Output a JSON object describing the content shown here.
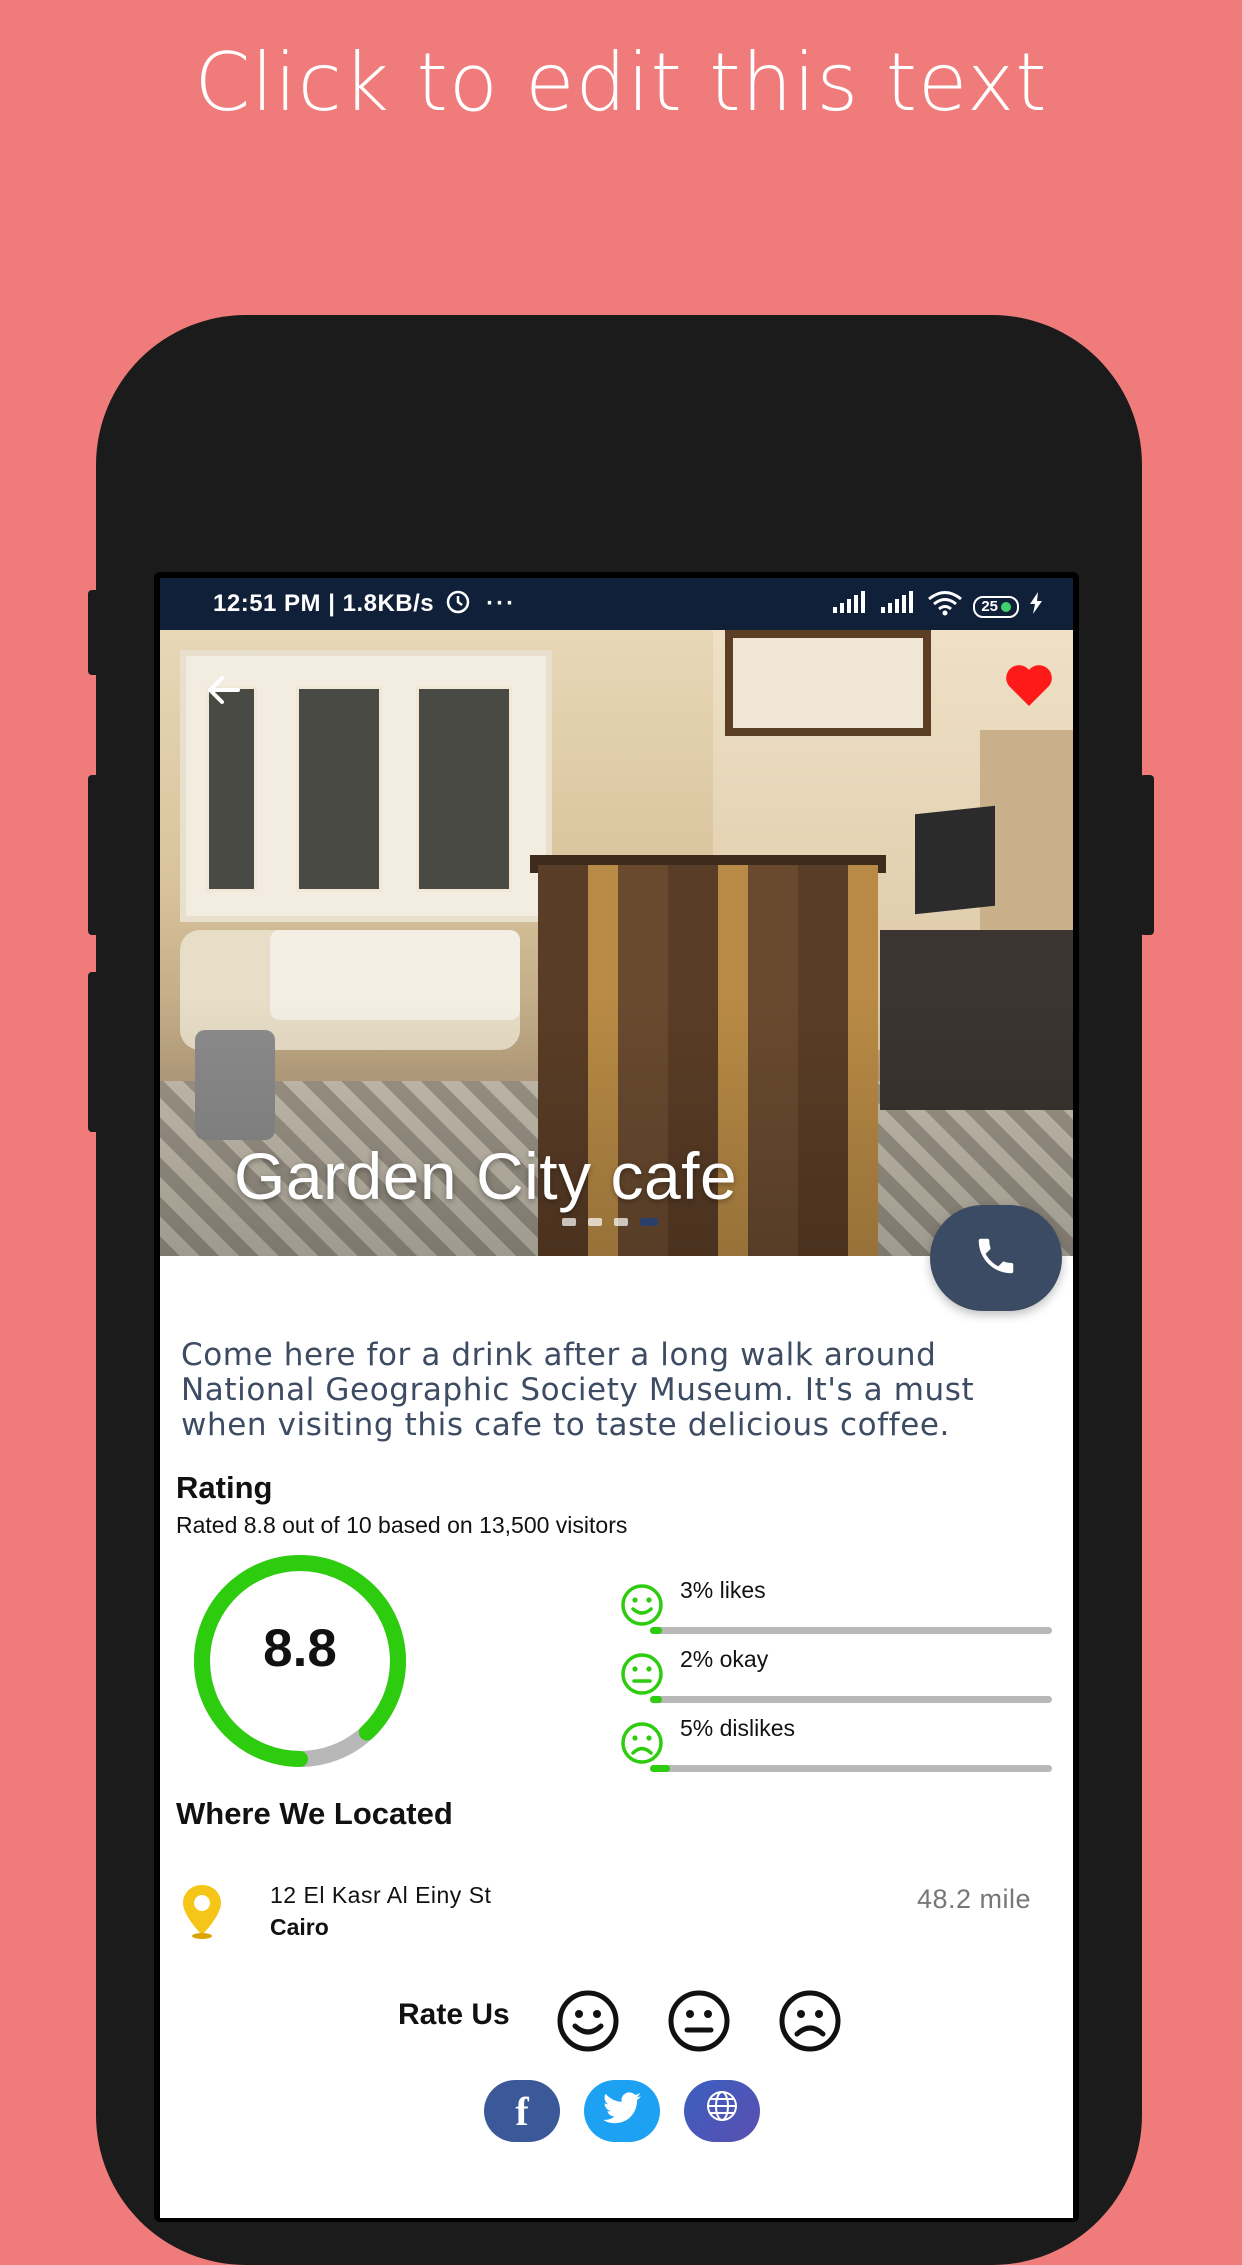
{
  "promo": {
    "text": "Click to edit this text"
  },
  "statusbar": {
    "time": "12:51 PM | 1.8KB/s",
    "battery": "25"
  },
  "hero": {
    "title": "Garden City cafe",
    "slides": 4,
    "active_slide": 4
  },
  "description": "Come here for a drink after a long walk around National Geographic Society Museum. It's a must when visiting this cafe to taste delicious coffee.",
  "rating": {
    "title": "Rating",
    "subtitle": "Rated 8.8 out of 10 based on 13,500 visitors",
    "score": "8.8",
    "score_value": 8.8,
    "score_max": 10,
    "stats": [
      {
        "label": "3% likes",
        "percent": 3,
        "icon": "smile-icon"
      },
      {
        "label": "2% okay",
        "percent": 2,
        "icon": "neutral-face-icon"
      },
      {
        "label": "5% dislikes",
        "percent": 5,
        "icon": "sad-face-icon"
      }
    ]
  },
  "location": {
    "title": "Where We Located",
    "address": "12 El Kasr Al Einy St",
    "city": "Cairo",
    "distance": "48.2 mile"
  },
  "rate_us": {
    "label": "Rate Us"
  },
  "colors": {
    "background": "#ef7c7b",
    "accent_green": "#2ecc0f",
    "call_button": "#3c4b64",
    "facebook": "#3b5998",
    "twitter": "#1da1f2"
  }
}
